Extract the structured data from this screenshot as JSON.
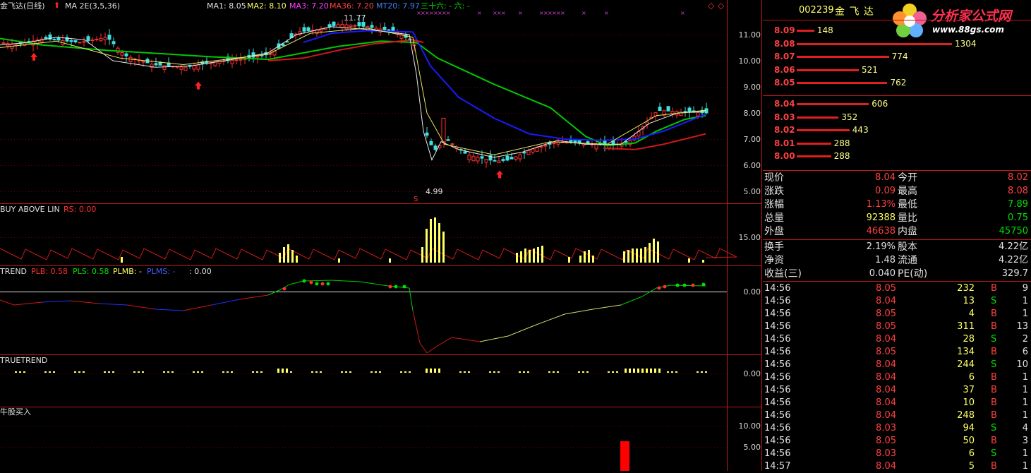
{
  "colors": {
    "bg": "#000000",
    "grid": "#800000",
    "red": "#ff3c3c",
    "green": "#00e000",
    "yellow": "#ffff66",
    "blue": "#1010ff",
    "ma_green": "#00d000",
    "ma_red": "#d01010",
    "axis": "#cc2020"
  },
  "main": {
    "title": "金飞达(日线)",
    "ma_label": "MA 2E(3,5,36)",
    "ma1": "MA1: 8.05",
    "ma2": "MA2: 8.10",
    "ma3": "MA3: 7.20",
    "ma36": "MA36: 7.20",
    "mt20": "MT20: 7.97",
    "extra": "三十六: - 六: -",
    "high_label": "11.77",
    "low_label": "4.99",
    "sell_mark": "S",
    "y_ticks": [
      "11.00",
      "10.00",
      "9.00",
      "8.00",
      "7.00",
      "6.00",
      "5.00"
    ]
  },
  "panel2": {
    "title": "BUY ABOVE LIN",
    "rs": "RS: 0.00",
    "y_ticks": [
      "15.00"
    ]
  },
  "panel3": {
    "title": "TREND",
    "plb": "PLB: 0.58",
    "pls": "PLS: 0.58",
    "plmb": "PLMB: -",
    "plms": "PLMS: -",
    "v": ": 0.00",
    "y_ticks": [
      "0.00"
    ]
  },
  "panel4": {
    "title": "TRUETREND",
    "y_ticks": [
      "0.00"
    ]
  },
  "panel5": {
    "title": "牛股买入",
    "y_ticks": [
      "10.00",
      "5.00"
    ]
  },
  "quote": {
    "code": "002239",
    "name": "金 飞 达",
    "logo_text": "分析家公式网",
    "logo_url": "www.88gs.com",
    "asks": [
      {
        "price": "8.09",
        "vol": "148",
        "r": 0.113
      },
      {
        "price": "8.08",
        "vol": "1304",
        "r": 1.0
      },
      {
        "price": "8.07",
        "vol": "774",
        "r": 0.594
      },
      {
        "price": "8.06",
        "vol": "521",
        "r": 0.4
      },
      {
        "price": "8.05",
        "vol": "762",
        "r": 0.584
      }
    ],
    "bids": [
      {
        "price": "8.04",
        "vol": "606",
        "r": 0.465
      },
      {
        "price": "8.03",
        "vol": "352",
        "r": 0.27
      },
      {
        "price": "8.02",
        "vol": "443",
        "r": 0.34
      },
      {
        "price": "8.01",
        "vol": "288",
        "r": 0.221
      },
      {
        "price": "8.00",
        "vol": "288",
        "r": 0.221
      }
    ],
    "stats": [
      {
        "l1": "现价",
        "v1": "8.04",
        "c1": "red",
        "l2": "今开",
        "v2": "8.02",
        "c2": "red"
      },
      {
        "l1": "涨跌",
        "v1": "0.09",
        "c1": "red",
        "l2": "最高",
        "v2": "8.08",
        "c2": "red"
      },
      {
        "l1": "涨幅",
        "v1": "1.13%",
        "c1": "red",
        "l2": "最低",
        "v2": "7.89",
        "c2": "green"
      },
      {
        "l1": "总量",
        "v1": "92388",
        "c1": "yellow",
        "l2": "量比",
        "v2": "0.75",
        "c2": "green"
      },
      {
        "l1": "外盘",
        "v1": "46638",
        "c1": "red",
        "l2": "内盘",
        "v2": "45750",
        "c2": "green"
      }
    ],
    "info": [
      {
        "l1": "换手",
        "v1": "2.19%",
        "l2": "股本",
        "v2": "4.22亿"
      },
      {
        "l1": "净资",
        "v1": "1.48",
        "l2": "流通",
        "v2": "4.22亿"
      },
      {
        "l1": "收益(三)",
        "v1": "0.040",
        "l2": "PE(动)",
        "v2": "329.7"
      }
    ],
    "ticks": [
      {
        "time": "14:56",
        "price": "8.05",
        "vol": "232",
        "bs": "B",
        "n": "9"
      },
      {
        "time": "14:56",
        "price": "8.04",
        "vol": "13",
        "bs": "S",
        "n": "1"
      },
      {
        "time": "14:56",
        "price": "8.05",
        "vol": "4",
        "bs": "B",
        "n": "1"
      },
      {
        "time": "14:56",
        "price": "8.05",
        "vol": "311",
        "bs": "B",
        "n": "13"
      },
      {
        "time": "14:56",
        "price": "8.04",
        "vol": "28",
        "bs": "S",
        "n": "2"
      },
      {
        "time": "14:56",
        "price": "8.05",
        "vol": "134",
        "bs": "B",
        "n": "6"
      },
      {
        "time": "14:56",
        "price": "8.04",
        "vol": "244",
        "bs": "S",
        "n": "10"
      },
      {
        "time": "14:56",
        "price": "8.04",
        "vol": "6",
        "bs": "B",
        "n": "1"
      },
      {
        "time": "14:56",
        "price": "8.04",
        "vol": "37",
        "bs": "B",
        "n": "1"
      },
      {
        "time": "14:56",
        "price": "8.04",
        "vol": "10",
        "bs": "B",
        "n": "1"
      },
      {
        "time": "14:56",
        "price": "8.04",
        "vol": "248",
        "bs": "B",
        "n": "1"
      },
      {
        "time": "14:56",
        "price": "8.03",
        "vol": "94",
        "bs": "S",
        "n": "4"
      },
      {
        "time": "14:56",
        "price": "8.05",
        "vol": "50",
        "bs": "B",
        "n": "3"
      },
      {
        "time": "14:56",
        "price": "8.03",
        "vol": "6",
        "bs": "S",
        "n": "1"
      },
      {
        "time": "14:57",
        "price": "8.04",
        "vol": "5",
        "bs": "B",
        "n": "1"
      }
    ]
  }
}
